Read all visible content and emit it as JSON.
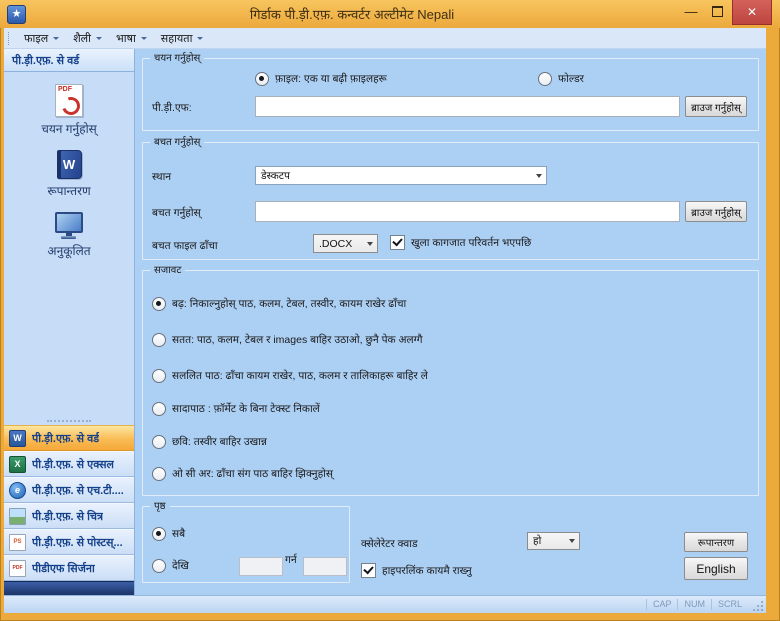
{
  "window": {
    "title": "गिर्डाक पी.ड़ी.एफ़. कन्वर्टर अल्टीमेट Nepali",
    "controls": {
      "minimize": "—",
      "close": "✕"
    }
  },
  "menubar": {
    "items": [
      {
        "label": "फाइल"
      },
      {
        "label": "शैली"
      },
      {
        "label": "भाषा"
      },
      {
        "label": "सहायता"
      }
    ]
  },
  "sidebar": {
    "header": "पी.ड़ी.एफ़. से वर्ड",
    "actions": [
      {
        "label": "चयन गर्नुहोस्",
        "icon": "pdf-file-icon"
      },
      {
        "label": "रूपान्तरण",
        "icon": "word-book-icon",
        "letter": "W"
      },
      {
        "label": "अनुकूलित",
        "icon": "computer-icon"
      }
    ],
    "nav_items": [
      {
        "label": "पी.ड़ी.एफ़. से वर्ड",
        "icon": "word-icon",
        "letter": "W",
        "selected": true
      },
      {
        "label": "पी.ड़ी.एफ़. से एक्सल",
        "icon": "excel-icon",
        "letter": "X",
        "selected": false
      },
      {
        "label": "पी.ड़ी.एफ़. से एच.टी....",
        "icon": "html-icon",
        "letter": "e",
        "selected": false
      },
      {
        "label": "पी.ड़ी.एफ़. से चित्र",
        "icon": "image-icon",
        "letter": "",
        "selected": false
      },
      {
        "label": "पी.ड़ी.एफ़. से पोस्टस्...",
        "icon": "postscript-icon",
        "letter": "PS",
        "selected": false
      },
      {
        "label": "पीडीएफ सिर्जना",
        "icon": "pdf-create-icon",
        "letter": "PDF",
        "selected": false
      }
    ]
  },
  "select_group": {
    "label": "चयन गर्नुहोस्",
    "radio_file": "फ़ाइल: एक या बढ़ी फ़ाइलहरू",
    "radio_file_selected": true,
    "radio_folder": "फोल्डर",
    "radio_folder_selected": false,
    "pdf_label": "पी.ड़ी.एफ:",
    "pdf_value": "",
    "browse_button": "ब्राउज गर्नुहोस्"
  },
  "save_group": {
    "label": "बचत गर्नुहोस्",
    "location_label": "स्थान",
    "location_value": "डेस्कटप",
    "save_label": "बचत गर्नुहोस्",
    "save_value": "",
    "browse_button": "ब्राउज गर्नुहोस्",
    "format_label": "बचत फाइल ढाँचा",
    "format_value": ".DOCX",
    "open_after_label": "खुला कागजात परिवर्तन भएपछि",
    "open_after_checked": true
  },
  "layout_group": {
    "label": "सजावट",
    "options": [
      {
        "label": "बढ़: निकाल्नुहोस् पाठ, कलम, टेबल, तस्वीर, कायम राखेर ढाँचा",
        "selected": true
      },
      {
        "label": "सतत: पाठ, कलम, टेबल र images बाहिर उठाओ, छुनै पेक अलग्गै",
        "selected": false
      },
      {
        "label": "सललित पाठ: ढाँचा कायम राखेर, पाठ, कलम र तालिकाहरू बाहिर ले",
        "selected": false
      },
      {
        "label": "सादापाठ : फ़ॉर्मेट के बिना टेक्स्ट निकालें",
        "selected": false
      },
      {
        "label": "छवि: तस्वीर बाहिर उखान्न",
        "selected": false
      },
      {
        "label": "ओ सी अर: ढाँचा संग पाठ बाहिर झिक्नुहोस्",
        "selected": false
      }
    ]
  },
  "page_group": {
    "label": "पृष्ठ",
    "all_label": "सबै",
    "all_selected": true,
    "from_label": "देखि",
    "from_selected": false,
    "from_value": "",
    "to_label": "गर्न",
    "to_value": ""
  },
  "bottom": {
    "accelerator_label": "क्सेलेरेटर क्वाड",
    "accelerator_value": "हो",
    "hyperlink_label": "हाइपरलिंक कायमै राख्नु",
    "hyperlink_checked": true,
    "convert_button": "रूपान्तरण",
    "english_button": "English"
  },
  "statusbar": {
    "panes": [
      "CAP",
      "NUM",
      "SCRL"
    ]
  },
  "colors": {
    "frame": "#ECA93C",
    "main_background": "#ACCFF4",
    "sidebar_background": "#C6DCF7",
    "selected_nav": "#F5A838",
    "close_button": "#BE4540",
    "header_text": "#15428B"
  }
}
